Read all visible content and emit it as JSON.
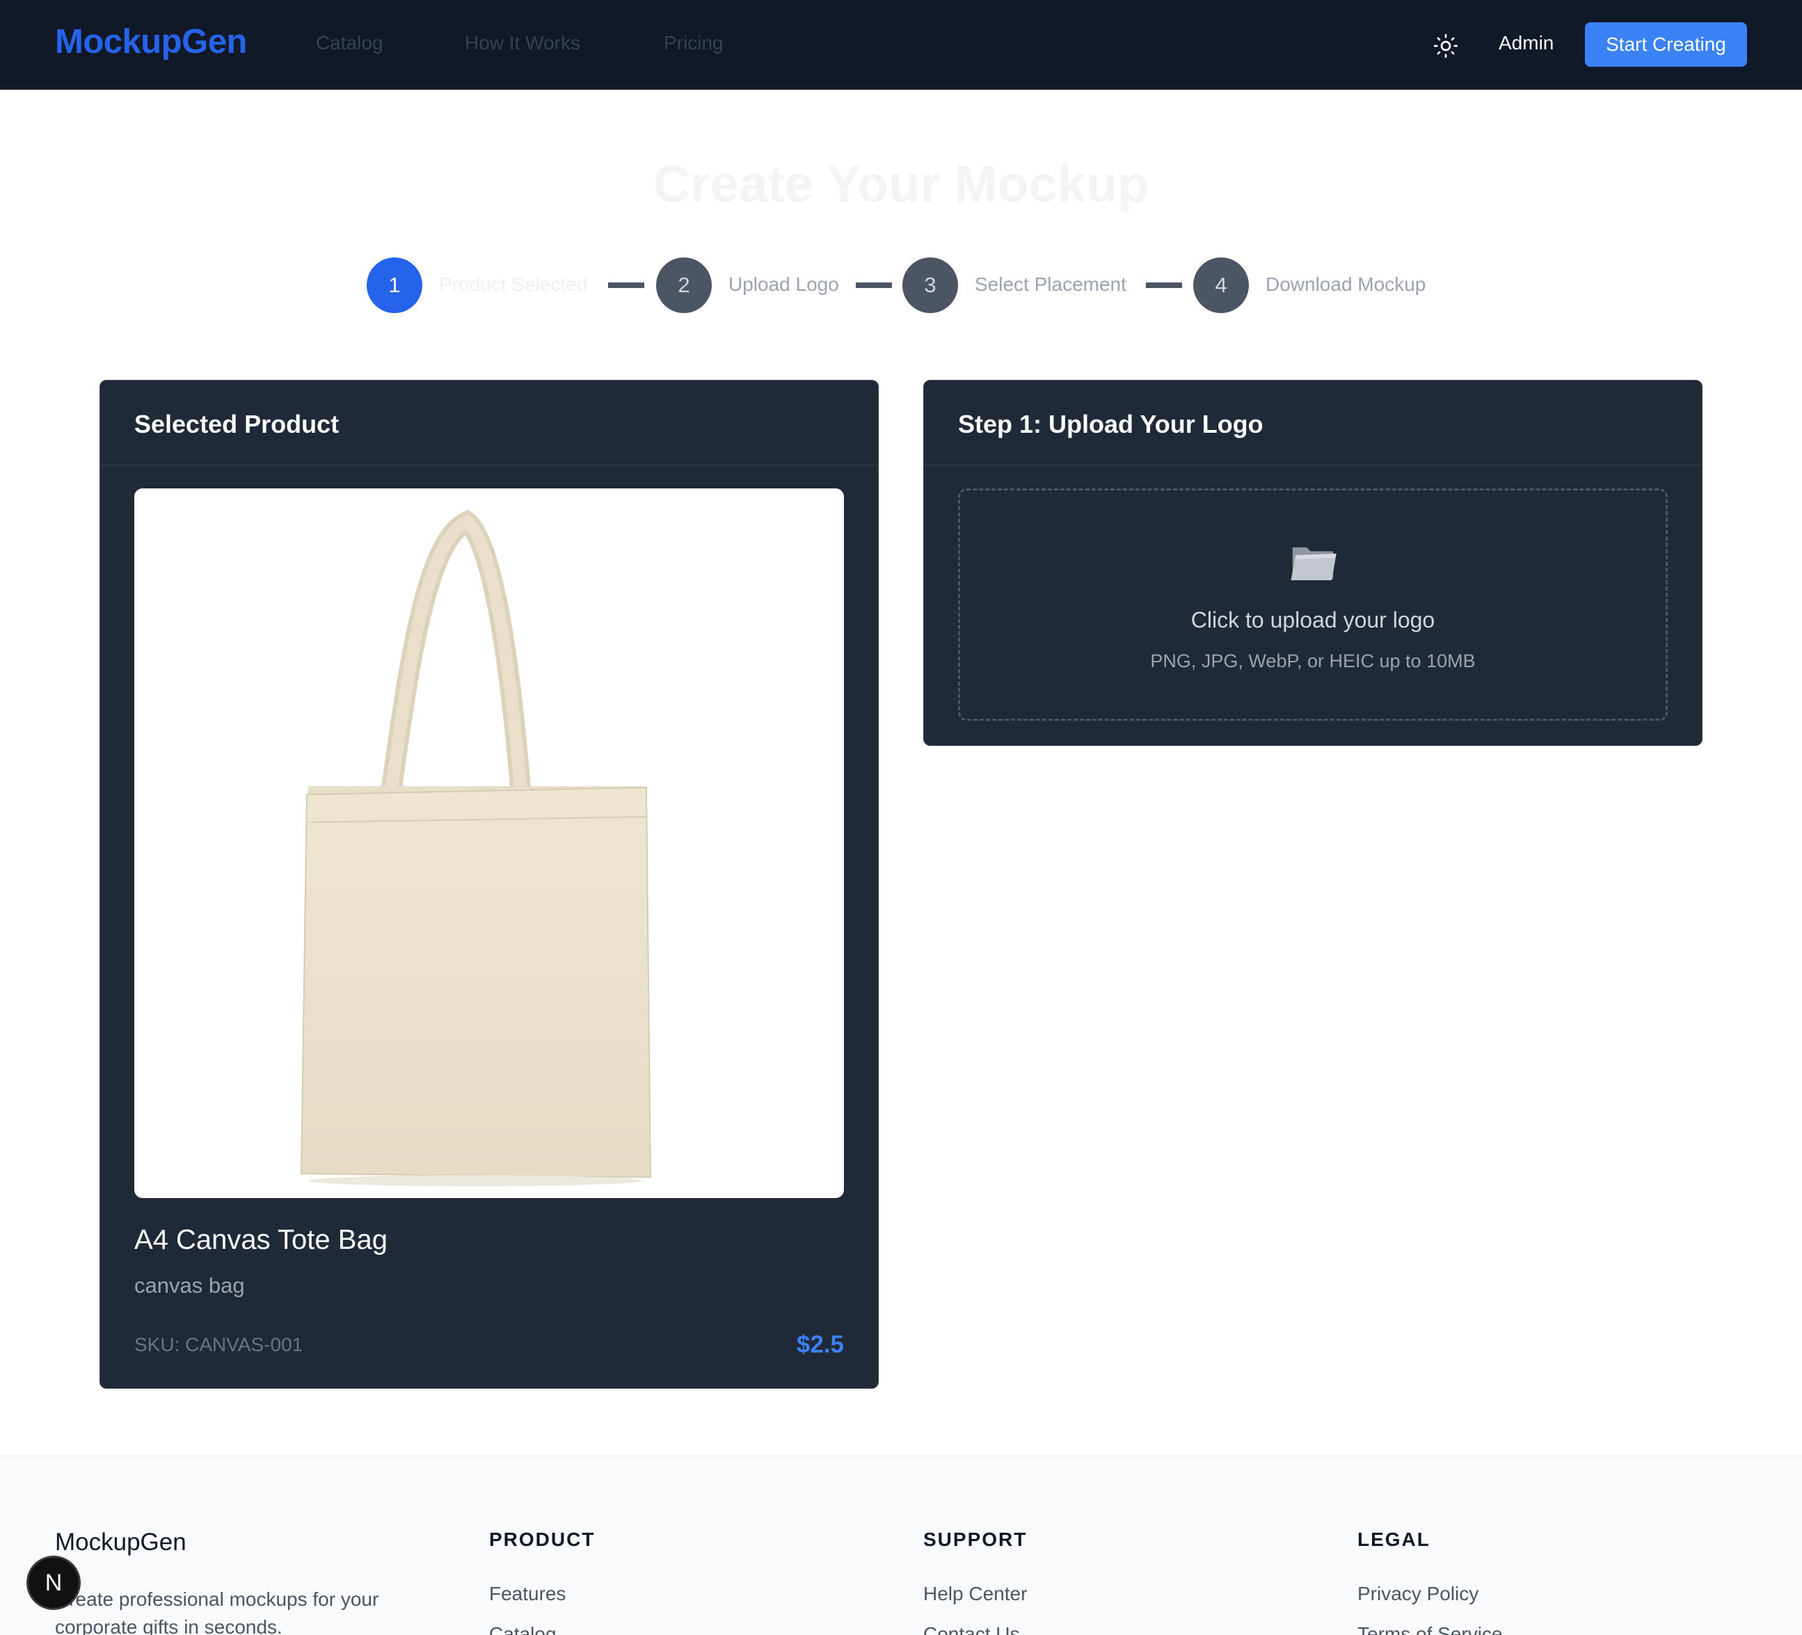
{
  "navbar": {
    "brand": "MockupGen",
    "links": [
      "Catalog",
      "How It Works",
      "Pricing"
    ],
    "theme_icon": "sun-icon",
    "admin_label": "Admin",
    "cta_label": "Start Creating"
  },
  "page": {
    "title": "Create Your Mockup"
  },
  "stepper": {
    "steps": [
      {
        "number": "1",
        "label": "Product Selected",
        "state": "active"
      },
      {
        "number": "2",
        "label": "Upload Logo",
        "state": "pending"
      },
      {
        "number": "3",
        "label": "Select Placement",
        "state": "pending"
      },
      {
        "number": "4",
        "label": "Download Mockup",
        "state": "pending"
      }
    ]
  },
  "product_card": {
    "header": "Selected Product",
    "name": "A4 Canvas Tote Bag",
    "category": "canvas bag",
    "sku": "SKU: CANVAS-001",
    "price": "$2.5"
  },
  "upload_card": {
    "header": "Step 1: Upload Your Logo",
    "icon": "folder-icon",
    "prompt": "Click to upload your logo",
    "hint": "PNG, JPG, WebP, or HEIC up to 10MB"
  },
  "footer": {
    "brand": "MockupGen",
    "tagline": "Create professional mockups for your corporate gifts in seconds.",
    "columns": [
      {
        "title": "PRODUCT",
        "links": [
          "Features",
          "Catalog"
        ]
      },
      {
        "title": "SUPPORT",
        "links": [
          "Help Center",
          "Contact Us"
        ]
      },
      {
        "title": "LEGAL",
        "links": [
          "Privacy Policy",
          "Terms of Service"
        ]
      }
    ]
  },
  "dev_badge": {
    "label": "N"
  },
  "colors": {
    "navbar_bg": "#111827",
    "card_bg": "#1f2937",
    "accent": "#3b82f6",
    "brand": "#2563eb"
  }
}
